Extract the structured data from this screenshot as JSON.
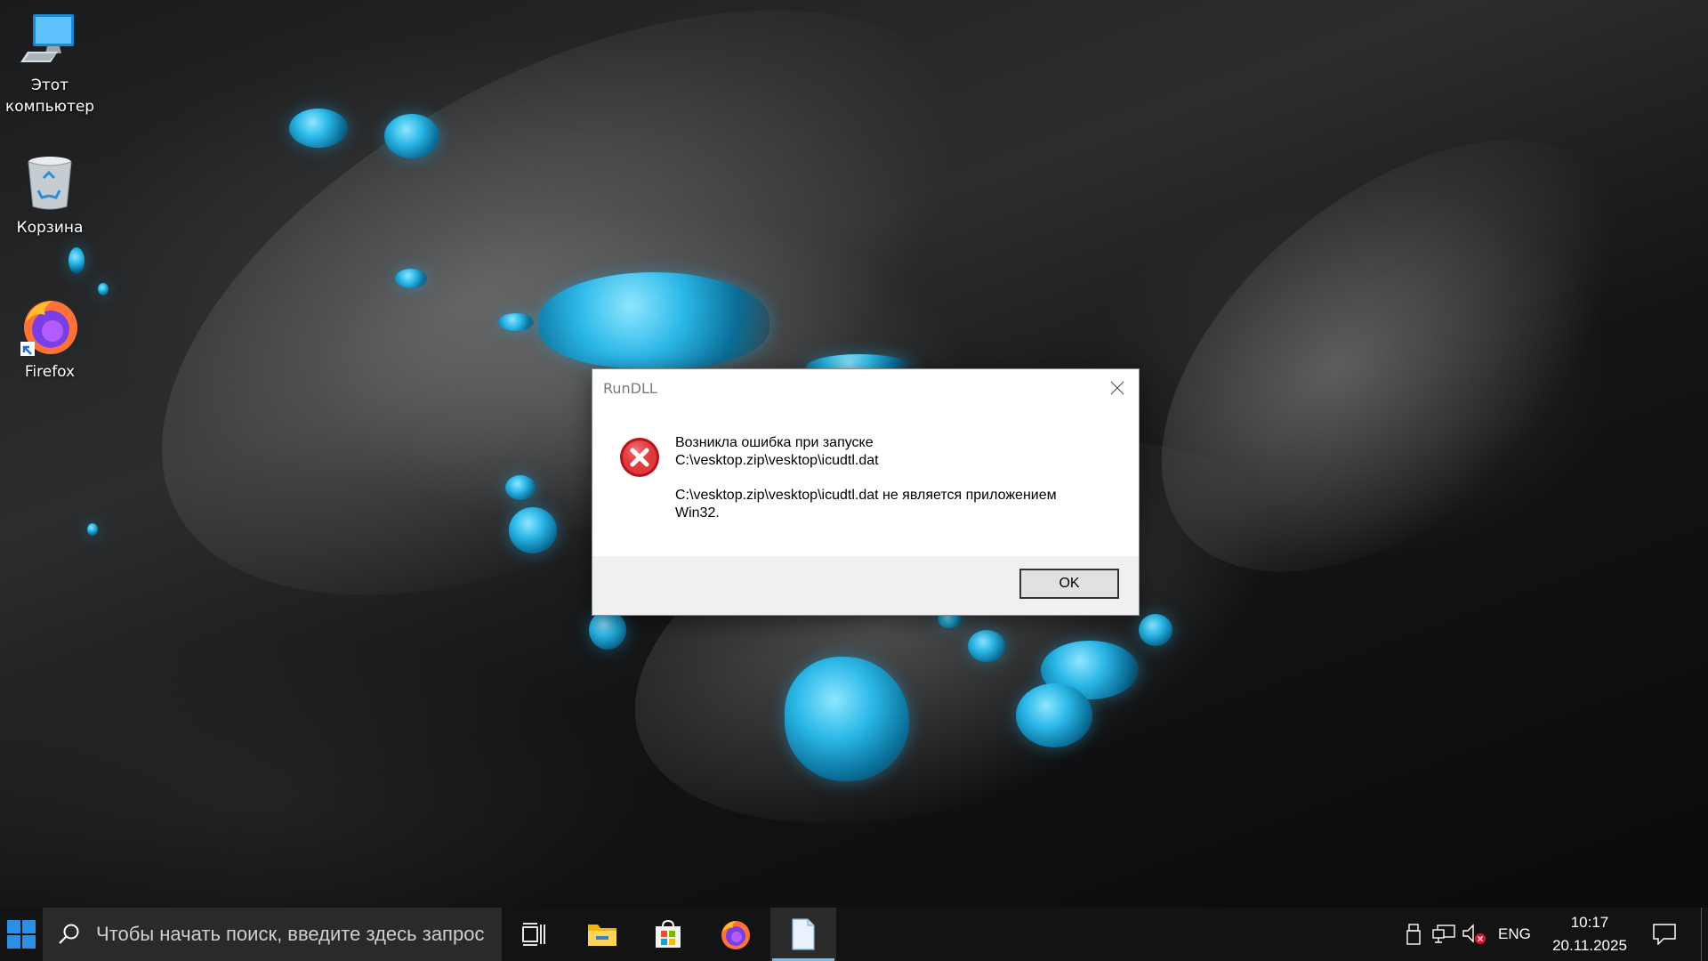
{
  "desktop": {
    "icons": [
      {
        "label": "Этот компьютер",
        "icon": "this-pc-icon"
      },
      {
        "label": "Корзина",
        "icon": "recycle-bin-icon"
      },
      {
        "label": "Firefox",
        "icon": "firefox-icon"
      }
    ]
  },
  "dialog": {
    "title": "RunDLL",
    "icon": "error-icon",
    "message_line1": "Возникла ошибка при запуске",
    "message_line2": "C:\\vesktop.zip\\vesktop\\icudtl.dat",
    "message_line3": "C:\\vesktop.zip\\vesktop\\icudtl.dat не является приложением",
    "message_line4": "Win32.",
    "ok_label": "OK"
  },
  "taskbar": {
    "search_placeholder": "Чтобы начать поиск, введите здесь запрос",
    "pinned": [
      {
        "name": "task-view",
        "icon": "task-view-icon"
      },
      {
        "name": "file-explorer",
        "icon": "folder-icon"
      },
      {
        "name": "microsoft-store",
        "icon": "store-icon"
      },
      {
        "name": "firefox",
        "icon": "firefox-icon"
      },
      {
        "name": "document",
        "icon": "document-icon",
        "active": true
      }
    ],
    "tray": {
      "language": "ENG",
      "time": "10:17",
      "date": "20.11.2025"
    }
  },
  "colors": {
    "taskbar_bg": "#131313",
    "search_bg": "#2a2a2a",
    "dialog_footer": "#f0f0f0",
    "accent": "#76b9ed",
    "error_red": "#d0212a"
  }
}
